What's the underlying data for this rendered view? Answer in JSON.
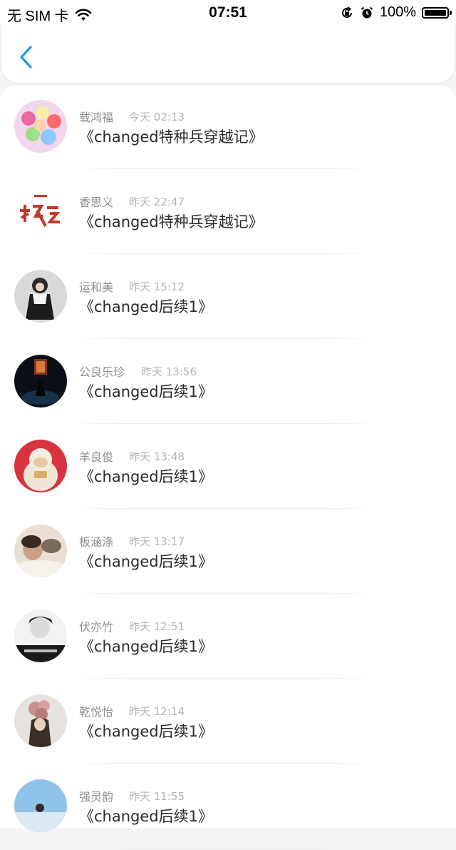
{
  "status_bar": {
    "carrier": "无 SIM 卡",
    "time": "07:51",
    "battery_text": "100%",
    "battery_level": 1.0,
    "icons": [
      "wifi-icon",
      "orientation-lock-icon",
      "alarm-icon",
      "battery-icon"
    ]
  },
  "nav": {
    "back_icon": "chevron-left-icon",
    "accent": "#1e9be0"
  },
  "comments": [
    {
      "name": "载鸿福",
      "time": "今天 02:13",
      "title": "《changed特种兵穿越记》"
    },
    {
      "name": "香思义",
      "time": "昨天 22:47",
      "title": "《changed特种兵穿越记》"
    },
    {
      "name": "运和美",
      "time": "昨天 15:12",
      "title": "《changed后续1》"
    },
    {
      "name": "公良乐珍",
      "time": "昨天 13:56",
      "title": "《changed后续1》"
    },
    {
      "name": "羊良俊",
      "time": "昨天 13:48",
      "title": "《changed后续1》"
    },
    {
      "name": "板涵涤",
      "time": "昨天 13:17",
      "title": "《changed后续1》"
    },
    {
      "name": "伏亦竹",
      "time": "昨天 12:51",
      "title": "《changed后续1》"
    },
    {
      "name": "乾悦怡",
      "time": "昨天 12:14",
      "title": "《changed后续1》"
    },
    {
      "name": "强灵韵",
      "time": "昨天 11:55",
      "title": "《changed后续1》"
    }
  ]
}
